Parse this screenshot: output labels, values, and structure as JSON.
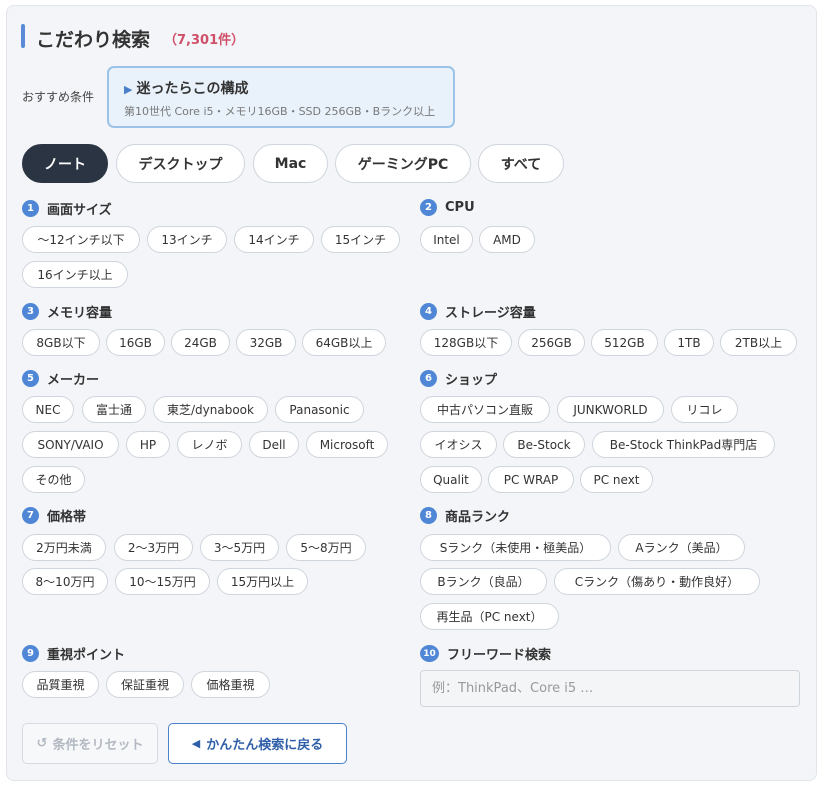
{
  "header": {
    "title": "こだわり検索",
    "count": "（7,301件）"
  },
  "recommend": {
    "label": "おすすめ条件",
    "title": "迷ったらこの構成",
    "subtitle": "第10世代 Core i5・メモリ16GB・SSD 256GB・Bランク以上"
  },
  "type_tabs": [
    {
      "label": "ノート",
      "active": true
    },
    {
      "label": "デスクトップ",
      "active": false
    },
    {
      "label": "Mac",
      "active": false
    },
    {
      "label": "ゲーミングPC",
      "active": false
    },
    {
      "label": "すべて",
      "active": false
    }
  ],
  "sections": {
    "screen": {
      "num": "1",
      "title": "画面サイズ",
      "options": [
        "〜12インチ以下",
        "13インチ",
        "14インチ",
        "15インチ",
        "16インチ以上"
      ]
    },
    "cpu": {
      "num": "2",
      "title": "CPU",
      "options": [
        "Intel",
        "AMD"
      ]
    },
    "memory": {
      "num": "3",
      "title": "メモリ容量",
      "options": [
        "8GB以下",
        "16GB",
        "24GB",
        "32GB",
        "64GB以上"
      ]
    },
    "storage": {
      "num": "4",
      "title": "ストレージ容量",
      "options": [
        "128GB以下",
        "256GB",
        "512GB",
        "1TB",
        "2TB以上"
      ]
    },
    "maker": {
      "num": "5",
      "title": "メーカー",
      "options": [
        "NEC",
        "富士通",
        "東芝/dynabook",
        "Panasonic",
        "SONY/VAIO",
        "HP",
        "レノボ",
        "Dell",
        "Microsoft",
        "その他"
      ]
    },
    "shop": {
      "num": "6",
      "title": "ショップ",
      "options": [
        "中古パソコン直販",
        "JUNKWORLD",
        "リコレ",
        "イオシス",
        "Be-Stock",
        "Be-Stock ThinkPad専門店",
        "Qualit",
        "PC WRAP",
        "PC next"
      ]
    },
    "price": {
      "num": "7",
      "title": "価格帯",
      "options": [
        "2万円未満",
        "2〜3万円",
        "3〜5万円",
        "5〜8万円",
        "8〜10万円",
        "10〜15万円",
        "15万円以上"
      ]
    },
    "rank": {
      "num": "8",
      "title": "商品ランク",
      "options": [
        "Sランク（未使用・極美品）",
        "Aランク（美品）",
        "Bランク（良品）",
        "Cランク（傷あり・動作良好）",
        "再生品（PC next）"
      ]
    },
    "focus": {
      "num": "9",
      "title": "重視ポイント",
      "options": [
        "品質重視",
        "保証重視",
        "価格重視"
      ]
    },
    "free": {
      "num": "10",
      "title": "フリーワード検索",
      "placeholder": "例：ThinkPad、Core i5 …"
    }
  },
  "buttons": {
    "reset": "条件をリセット",
    "back": "かんたん検索に戻る"
  },
  "colors": {
    "accent": "#4f87d6",
    "active_tab": "#2b3442",
    "count": "#d0506a"
  }
}
